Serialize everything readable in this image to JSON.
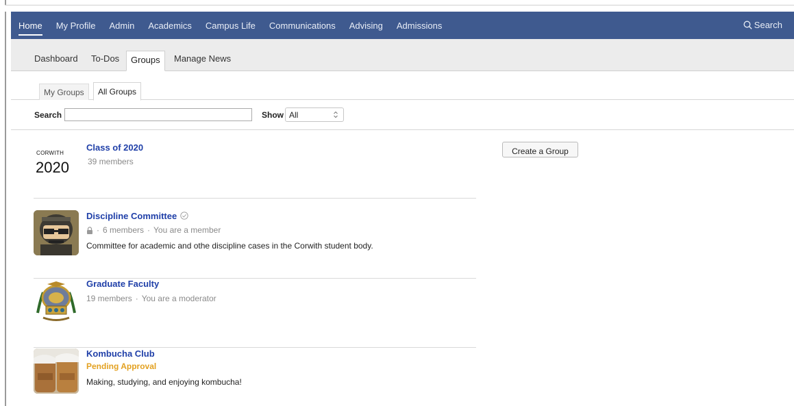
{
  "topnav": {
    "items": [
      {
        "label": "Home",
        "active": true
      },
      {
        "label": "My Profile"
      },
      {
        "label": "Admin"
      },
      {
        "label": "Academics"
      },
      {
        "label": "Campus Life"
      },
      {
        "label": "Communications"
      },
      {
        "label": "Advising"
      },
      {
        "label": "Admissions"
      }
    ],
    "search_label": "Search",
    "search_icon": "search-icon",
    "background_color": "#3f5a8f"
  },
  "subnav": {
    "items": [
      {
        "label": "Dashboard"
      },
      {
        "label": "To-Dos"
      },
      {
        "label": "Groups",
        "active": true
      },
      {
        "label": "Manage News"
      }
    ]
  },
  "tabs": [
    {
      "label": "My Groups"
    },
    {
      "label": "All Groups",
      "active": true
    }
  ],
  "filters": {
    "search_label": "Search",
    "search_value": "",
    "show_label": "Show",
    "show_value": "All"
  },
  "create_button_label": "Create a Group",
  "groups": [
    {
      "name": "Class of 2020",
      "thumb_text_top": "CORWITH",
      "thumb_text_main": "2020",
      "members": "39 members"
    },
    {
      "name": "Discipline Committee",
      "verified_icon": "check-circle-icon",
      "lock_icon": "lock-icon",
      "members": "6 members",
      "role": "You are a member",
      "description": "Committee for academic and othe  discipline cases in the Corwith student body."
    },
    {
      "name": "Graduate Faculty",
      "members": "19 members",
      "role": "You are a moderator"
    },
    {
      "name": "Kombucha Club",
      "status": "Pending Approval",
      "description": "Making, studying, and enjoying kombucha!"
    }
  ],
  "colors": {
    "link": "#1f3fa8",
    "pending": "#e3a121",
    "meta": "#8a8a8a"
  }
}
